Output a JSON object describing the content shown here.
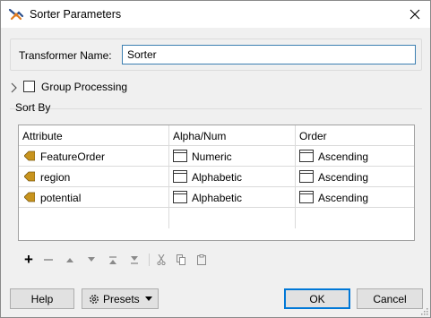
{
  "window": {
    "title": "Sorter Parameters"
  },
  "transformer": {
    "label": "Transformer Name:",
    "value": "Sorter"
  },
  "group_processing": {
    "label": "Group Processing",
    "checked": false
  },
  "sort_by": {
    "legend": "Sort By",
    "columns": [
      "Attribute",
      "Alpha/Num",
      "Order"
    ],
    "rows": [
      {
        "attribute": "FeatureOrder",
        "alpha_num": "Numeric",
        "order": "Ascending"
      },
      {
        "attribute": "region",
        "alpha_num": "Alphabetic",
        "order": "Ascending"
      },
      {
        "attribute": "potential",
        "alpha_num": "Alphabetic",
        "order": "Ascending"
      }
    ]
  },
  "toolbar": {
    "icons": [
      "add-icon",
      "remove-icon",
      "move-up-icon",
      "move-down-icon",
      "move-top-icon",
      "move-bottom-icon",
      "cut-icon",
      "copy-icon",
      "paste-icon"
    ]
  },
  "buttons": {
    "help": "Help",
    "presets": "Presets",
    "ok": "OK",
    "cancel": "Cancel"
  },
  "colors": {
    "accent": "#0078d7",
    "attribute_icon": "#c8941e"
  }
}
